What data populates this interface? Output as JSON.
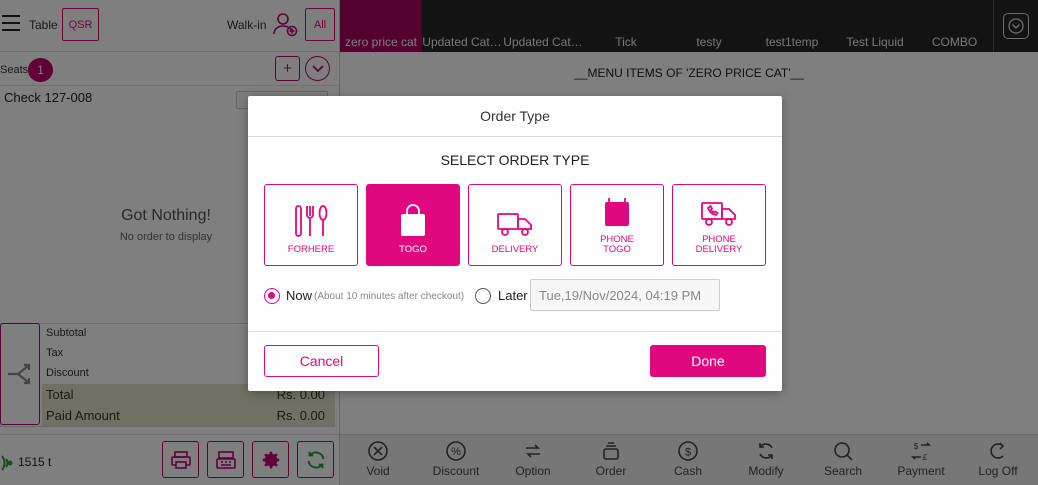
{
  "colors": {
    "accent": "#e0087e",
    "accent_dark": "#c2006e",
    "category_bar": "#262626"
  },
  "left": {
    "table_label": "Table",
    "qsr_label": "QSR",
    "walkin_label": "Walk-in",
    "all_label": "All",
    "seats_label": "Seats",
    "seat_count": "1",
    "add_label": "+",
    "check_label": "Check",
    "check_number": "127-008",
    "empty_title": "Got Nothing!",
    "empty_sub": "No order to display",
    "totals": {
      "subtotal_label": "Subtotal",
      "tax_label": "Tax",
      "discount_label": "Discount",
      "total_label": "Total",
      "total_value": "Rs. 0.00",
      "paid_label": "Paid Amount",
      "paid_value": "Rs. 0.00"
    },
    "signal_text": "1515 t"
  },
  "categories": [
    {
      "label": "zero price cat",
      "active": true
    },
    {
      "label": "Updated Cat…"
    },
    {
      "label": "Updated Cat…"
    },
    {
      "label": "Tick"
    },
    {
      "label": "testy"
    },
    {
      "label": "test1temp"
    },
    {
      "label": "Test Liquid"
    },
    {
      "label": "COMBO"
    }
  ],
  "menu_title": "__MENU ITEMS OF 'ZERO PRICE CAT'__",
  "actions": [
    {
      "label": "Void",
      "icon": "void-icon"
    },
    {
      "label": "Discount",
      "icon": "discount-icon"
    },
    {
      "label": "Option",
      "icon": "option-icon"
    },
    {
      "label": "Order",
      "icon": "order-icon"
    },
    {
      "label": "Cash",
      "icon": "cash-icon"
    },
    {
      "label": "Modify",
      "icon": "modify-icon"
    },
    {
      "label": "Search",
      "icon": "search-icon"
    },
    {
      "label": "Payment",
      "icon": "payment-icon"
    },
    {
      "label": "Log Off",
      "icon": "logoff-icon"
    }
  ],
  "dialog": {
    "title": "Order Type",
    "subtitle": "SELECT ORDER TYPE",
    "options": [
      {
        "label": "FORHERE",
        "icon": "utensils-icon"
      },
      {
        "label": "TOGO",
        "icon": "bag-icon",
        "selected": true
      },
      {
        "label": "DELIVERY",
        "icon": "truck-icon"
      },
      {
        "label": "Phone TOGO",
        "line1": "Phone",
        "line2": "TOGO",
        "icon": "phone-bag-icon"
      },
      {
        "label": "Phone DELIVERY",
        "line1": "Phone",
        "line2": "DELIVERY",
        "icon": "phone-truck-icon"
      }
    ],
    "now_label": "Now",
    "now_hint": "(About 10 minutes after checkout)",
    "later_label": "Later",
    "later_value": "Tue,19/Nov/2024, 04:19 PM",
    "cancel_label": "Cancel",
    "done_label": "Done"
  }
}
